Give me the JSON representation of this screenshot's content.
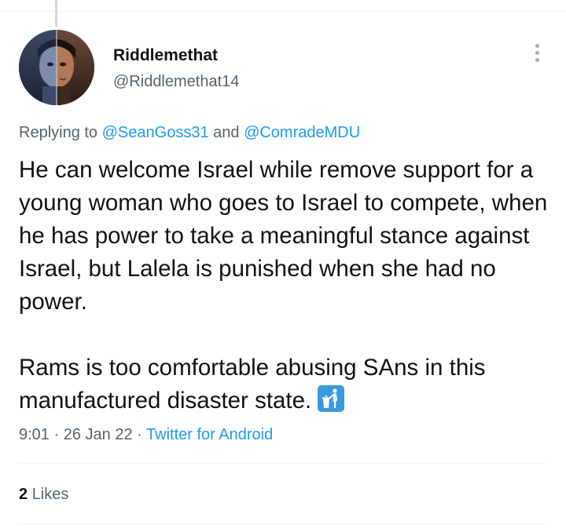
{
  "tweet": {
    "author": {
      "display_name": "Riddlemethat",
      "handle": "@Riddlemethat14"
    },
    "replying": {
      "prefix": "Replying to",
      "user1": "@SeanGoss31",
      "conjunction": "and",
      "user2": "@ComradeMDU"
    },
    "text": {
      "paragraph1": "He can welcome Israel while remove support for a young woman who goes to Israel to compete, when he has power to take a meaningful stance against Israel, but Lalela is punished when she had no power.",
      "paragraph2": "Rams is too comfortable abusing SAns in this manufactured disaster state."
    },
    "emoji": "litter-in-bin-sign",
    "meta": {
      "time": "9:01",
      "separator1": "·",
      "date": "26 Jan 22",
      "separator2": "·",
      "source": "Twitter for Android"
    },
    "stats": {
      "likes_count": "2",
      "likes_label": "Likes"
    }
  },
  "colors": {
    "text_primary": "#0f1419",
    "text_secondary": "#536471",
    "link": "#1d9bf0",
    "divider": "#eff3f4",
    "emoji_bg": "#3b99e0"
  }
}
